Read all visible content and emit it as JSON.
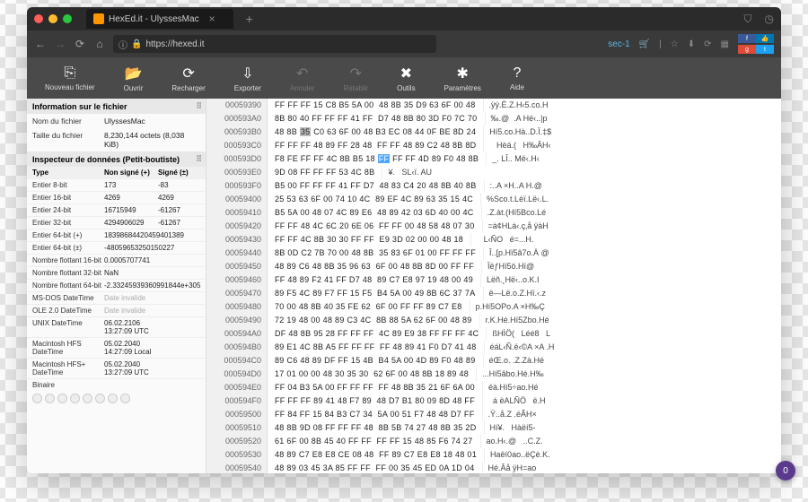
{
  "tab": {
    "title": "HexEd.it - UlyssesMac"
  },
  "titlebar_icons": {
    "shield": "⛉",
    "clock": "◷"
  },
  "url": {
    "scheme_icon": "ⓘ",
    "lock": "🔒",
    "text": "https://hexed.it"
  },
  "urlright": {
    "sec": "sec-1",
    "cart": "🛒",
    "star": "☆",
    "dl": "⬇",
    "hist": "⟳",
    "box": "▦"
  },
  "toolbar": [
    {
      "icon": "⎘",
      "label": "Nouveau fichier"
    },
    {
      "icon": "📂",
      "label": "Ouvrir"
    },
    {
      "icon": "⟳",
      "label": "Recharger"
    },
    {
      "icon": "⇩",
      "label": "Exporter"
    },
    {
      "icon": "↶",
      "label": "Annuler",
      "dim": true
    },
    {
      "icon": "↷",
      "label": "Rétablir",
      "dim": true
    },
    {
      "icon": "✕",
      "label": "",
      "dim": true,
      "hidden": true
    },
    {
      "icon": "✖",
      "label": "Outils"
    },
    {
      "icon": "✱",
      "label": "Paramètres"
    },
    {
      "icon": "?",
      "label": "Aide"
    }
  ],
  "fileinfo": {
    "header": "Information sur le fichier",
    "name_label": "Nom du fichier",
    "name_val": "UlyssesMac",
    "size_label": "Taille du fichier",
    "size_val": "8,230,144 octets (8,038 KiB)"
  },
  "inspector": {
    "header": "Inspecteur de données (Petit-boutiste)",
    "col_type": "Type",
    "col_unsigned": "Non signé (+)",
    "col_signed": "Signé (±)",
    "rows": [
      {
        "t": "Entier 8-bit",
        "u": "173",
        "s": "-83"
      },
      {
        "t": "Entier 16-bit",
        "u": "4269",
        "s": "4269"
      },
      {
        "t": "Entier 24-bit",
        "u": "16715949",
        "s": "-61267"
      },
      {
        "t": "Entier 32-bit",
        "u": "4294906029",
        "s": "-61267"
      },
      {
        "t": "Entier 64-bit (+)",
        "u": "18398684420459401389",
        "s": ""
      },
      {
        "t": "Entier 64-bit (±)",
        "u": "-48059653250150227",
        "s": ""
      },
      {
        "t": "Nombre flottant 16-bit",
        "u": "0.0005707741",
        "s": ""
      },
      {
        "t": "Nombre flottant 32-bit",
        "u": "NaN",
        "s": ""
      },
      {
        "t": "Nombre flottant 64-bit",
        "u": "-2.33245939360991844e+305",
        "s": ""
      },
      {
        "t": "MS-DOS DateTime",
        "u": "Date invalide",
        "s": "",
        "dim": true
      },
      {
        "t": "OLE 2.0 DateTime",
        "u": "Date invalide",
        "s": "",
        "dim": true
      },
      {
        "t": "UNIX DateTime",
        "u": "06.02.2106 13:27:09 UTC",
        "s": ""
      },
      {
        "t": "Macintosh HFS DateTime",
        "u": "05.02.2040 14:27:09 Local",
        "s": ""
      },
      {
        "t": "Macintosh HFS+ DateTime",
        "u": "05.02.2040 13:27:09 UTC",
        "s": ""
      },
      {
        "t": "Binaire",
        "u": "",
        "s": ""
      }
    ]
  },
  "hex": {
    "rows": [
      {
        "o": "00059390",
        "b": "FF FF FF 15 C8 B5 5A 00  48 8B 35 D9 63 6F 00 48",
        "a": ".ÿÿ.È.Z.H‹5.co.H"
      },
      {
        "o": "000593A0",
        "b": "8B 80 40 FF FF FF 41 FF  D7 48 8B 80 3D F0 7C 70",
        "a": "‰.@  .A Hé‹..|p"
      },
      {
        "o": "000593B0",
        "b": "48 8B 35 C0 63 6F 00 48  B3 EC 08 44 0F BE 8D 24",
        "a": "Hí5.co.Hà..D.Ï.‡$"
      },
      {
        "o": "000593C0",
        "b": "FF FF FF 48 89 FF 28 48  FF FF 48 89 C2 48 8B 8D",
        "a": "   Hèá.(   H‰ÂH‹"
      },
      {
        "o": "000593D0",
        "b": "F8 FE FF FF 4C 8B B5 18  FF FF FF 4D 89 F0 48 8B",
        "a": "_. LÎ.. Më‹.H‹"
      },
      {
        "o": "000593E0",
        "b": "9D 08 FF FF FF 53 4C 8B",
        "a": "¥.   SL‹ï. AU"
      },
      {
        "o": "000593F0",
        "b": "B5 00 FF FF FF 41 FF D7  48 83 C4 20 48 8B 40 8B",
        "a": ":..A ×H..A H.@"
      },
      {
        "o": "00059400",
        "b": "25 53 63 6F 00 74 10 4C  89 EF 4C 89 63 35 15 4C",
        "a": "%Sco.t.Lèï.Lë‹.L."
      },
      {
        "o": "00059410",
        "b": "B5 5A 00 48 07 4C 89 E6  48 89 42 03 6D 40 00 4C",
        "a": ".Z.àt.(Hï5Bco.Lé"
      },
      {
        "o": "00059420",
        "b": "FF FF 48 4C 6C 20 6E 06  FF FF 00 48 58 48 07 30",
        "a": "=à¢HLà‹.ç‚å ÿàH"
      },
      {
        "o": "00059430",
        "b": "FF FF 4C 8B 30 30 FF FF  E9 3D 02 00 00 48 18",
        "a": "   L‹ÑO   é=...H."
      },
      {
        "o": "00059440",
        "b": "8B 0D C2 7B 70 00 48 8B  35 83 6F 01 00 FF FF FF",
        "a": "Î..[p.Hï5â7o.À @"
      },
      {
        "o": "00059450",
        "b": "48 89 C6 48 8B 35 96 63  6F 00 48 8B 8D 00 FF FF",
        "a": "ÏëƒHï5ö.Hï@   "
      },
      {
        "o": "00059460",
        "b": "FF 48 89 F2 41 FF D7 48  89 C7 E8 97 19 48 00 49",
        "a": "Lëñ.¸Hë‹..o.K.I"
      },
      {
        "o": "00059470",
        "b": "89 F5 4C 89 F7 FF 15 F5  B4 5A 00 49 8B 6C 37 7A",
        "a": "ë—Lë.o.Z.Hï.‹.z"
      },
      {
        "o": "00059480",
        "b": "70 00 48 8B 40 35 FE 62  6F 00 FF FF 89 C7 E8",
        "a": "p.Hí5OPo.A ×H‰Ç"
      },
      {
        "o": "00059490",
        "b": "72 19 48 00 48 89 C3 4C  8B 88 5A 62 6F 00 48 89",
        "a": "r.K.Hé.Hí5Zbo.Hé"
      },
      {
        "o": "000594A0",
        "b": "DF 48 8B 95 28 FF FF FF  4C 89 E9 38 FF FF FF 4C",
        "a": "ßHÌÖ(   Léé8   L"
      },
      {
        "o": "000594B0",
        "b": "89 E1 4C 8B A5 FF FF FF  FF 48 89 41 F0 D7 41 48",
        "a": "éáL‹Ñ.ë‹©A ×A .H"
      },
      {
        "o": "000594C0",
        "b": "89 C6 48 89 DF FF 15 4B  B4 5A 00 4D 89 F0 48 89",
        "a": "éŒ.o. .Z.Zà.Hé"
      },
      {
        "o": "000594D0",
        "b": "17 01 00 00 48 30 35 30  62 6F 00 48 8B 18 89 48",
        "a": "...Hí5âbo.Hé.H‰"
      },
      {
        "o": "000594E0",
        "b": "FF 04 B3 5A 00 FF FF FF  FF 48 8B 35 21 6F 6A 00",
        "a": "éà.Hí5÷ao.Hé"
      },
      {
        "o": "000594F0",
        "b": "FF FF FF 89 41 48 F7 89  48 D7 B1 80 09 8D 48 FF",
        "a": "  á ëALÑÖ   ë.H"
      },
      {
        "o": "00059500",
        "b": "FF 84 FF 15 84 B3 C7 34  5A 00 51 F7 48 48 D7 FF",
        "a": ".Ÿ..å.Z .éÃH×"
      },
      {
        "o": "00059510",
        "b": "48 8B 9D 08 FF FF FF 48  8B 5B 74 27 48 8B 35 2D",
        "a": "Hí¥.   Hàëí5-"
      },
      {
        "o": "00059520",
        "b": "61 6F 00 8B 45 40 FF FF  FF FF 15 48 85 F6 74 27",
        "a": "ao.H‹.@   ..C.Z."
      },
      {
        "o": "00059530",
        "b": "48 89 C7 E8 E8 CE 08 48  FF 89 C7 E8 E8 18 48 01",
        "a": "Haëí0ao..ëÇè.K."
      },
      {
        "o": "00059540",
        "b": "48 89 03 45 3A 85 FF FF  FF 00 35 45 ED 0A 1D 04",
        "a": "Hé.Âå ÿH=ao"
      }
    ],
    "selected_row": 4,
    "selected_col": 8,
    "hl_row": 2,
    "hl_col": 2
  },
  "badge": "0"
}
